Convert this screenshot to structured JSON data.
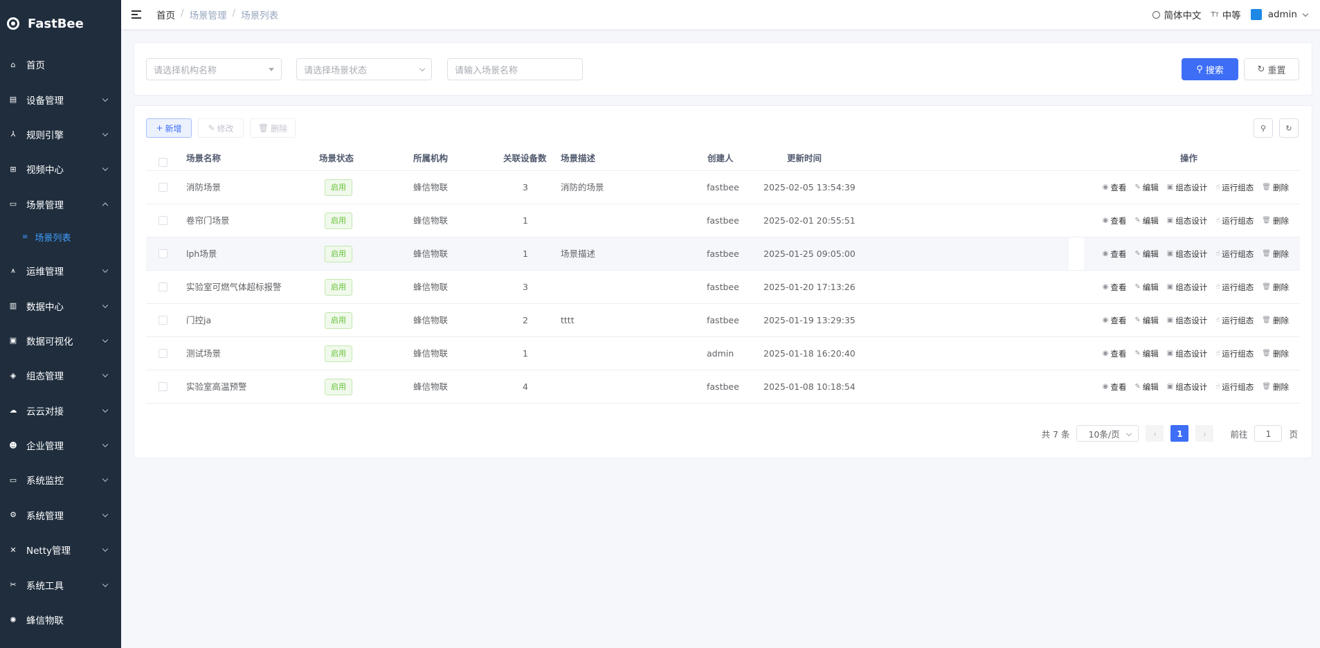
{
  "app": {
    "name": "FastBee"
  },
  "sidebar": {
    "items": [
      {
        "label": "首页",
        "icon": "home-icon"
      },
      {
        "label": "设备管理",
        "icon": "device-icon"
      },
      {
        "label": "规则引擎",
        "icon": "rule-engine-icon"
      },
      {
        "label": "视频中心",
        "icon": "video-icon"
      },
      {
        "label": "场景管理",
        "icon": "scene-icon",
        "expanded": true
      },
      {
        "label": "运维管理",
        "icon": "ops-icon"
      },
      {
        "label": "数据中心",
        "icon": "data-icon"
      },
      {
        "label": "数据可视化",
        "icon": "visual-icon"
      },
      {
        "label": "组态管理",
        "icon": "layers-icon"
      },
      {
        "label": "云云对接",
        "icon": "cloud-icon"
      },
      {
        "label": "企业管理",
        "icon": "enterprise-icon"
      },
      {
        "label": "系统监控",
        "icon": "monitor-icon"
      },
      {
        "label": "系统管理",
        "icon": "system-icon"
      },
      {
        "label": "Netty管理",
        "icon": "netty-icon"
      },
      {
        "label": "系统工具",
        "icon": "tools-icon"
      },
      {
        "label": "蜂信物联",
        "icon": "bee-icon"
      }
    ],
    "sub_item": {
      "label": "场景列表",
      "icon": "list-icon"
    }
  },
  "navbar": {
    "breadcrumb": [
      "首页",
      "场景管理",
      "场景列表"
    ],
    "language": "简体中文",
    "size": "中等",
    "user": "admin"
  },
  "search": {
    "org_placeholder": "请选择机构名称",
    "status_placeholder": "请选择场景状态",
    "name_placeholder": "请输入场景名称",
    "search_label": "搜索",
    "reset_label": "重置"
  },
  "toolbar": {
    "add": "新增",
    "edit": "修改",
    "delete": "删除"
  },
  "table": {
    "columns": [
      "场景名称",
      "场景状态",
      "所属机构",
      "关联设备数",
      "场景描述",
      "创建人",
      "更新时间",
      "操作"
    ],
    "rows": [
      {
        "name": "消防场景",
        "status": "启用",
        "org": "蜂信物联",
        "devices": "3",
        "desc": "消防的场景",
        "creator": "fastbee",
        "updated": "2025-02-05 13:54:39"
      },
      {
        "name": "卷帘门场景",
        "status": "启用",
        "org": "蜂信物联",
        "devices": "1",
        "desc": "",
        "creator": "fastbee",
        "updated": "2025-02-01 20:55:51"
      },
      {
        "name": "lph场景",
        "status": "启用",
        "org": "蜂信物联",
        "devices": "1",
        "desc": "场景描述",
        "creator": "fastbee",
        "updated": "2025-01-25 09:05:00"
      },
      {
        "name": "实验室可燃气体超标报警",
        "status": "启用",
        "org": "蜂信物联",
        "devices": "3",
        "desc": "",
        "creator": "fastbee",
        "updated": "2025-01-20 17:13:26"
      },
      {
        "name": "门控ja",
        "status": "启用",
        "org": "蜂信物联",
        "devices": "2",
        "desc": "tttt",
        "creator": "fastbee",
        "updated": "2025-01-19 13:29:35"
      },
      {
        "name": "测试场景",
        "status": "启用",
        "org": "蜂信物联",
        "devices": "1",
        "desc": "",
        "creator": "admin",
        "updated": "2025-01-18 16:20:40"
      },
      {
        "name": "实验室高温预警",
        "status": "启用",
        "org": "蜂信物联",
        "devices": "4",
        "desc": "",
        "creator": "fastbee",
        "updated": "2025-01-08 10:18:54"
      }
    ],
    "actions": [
      "查看",
      "编辑",
      "组态设计",
      "运行组态",
      "删除"
    ]
  },
  "pagination": {
    "total": "共 7 条",
    "page_size": "10条/页",
    "current": "1",
    "goto_prefix": "前往",
    "goto_value": "1",
    "goto_suffix": "页"
  },
  "colors": {
    "sidebar_bg": "#1f2d3d",
    "primary": "#3d6ef5",
    "success": "#67c23a"
  }
}
